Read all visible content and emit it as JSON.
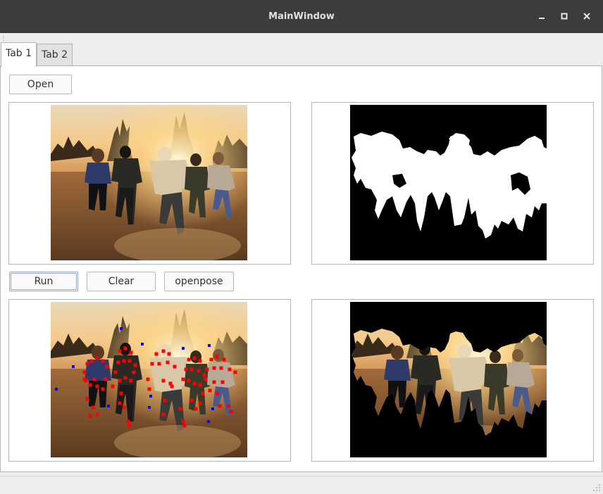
{
  "window": {
    "title": "MainWindow"
  },
  "tabs": [
    {
      "label": "Tab 1",
      "active": true
    },
    {
      "label": "Tab 2",
      "active": false
    }
  ],
  "toolbar": {
    "open_label": "Open",
    "run_label": "Run",
    "clear_label": "Clear",
    "openpose_label": "openpose"
  },
  "colors": {
    "titlebar": "#3c3c3c",
    "keypoint_red": "#ff0000",
    "keypoint_blue": "#0000ff",
    "mask_bg": "#000000",
    "mask_fg": "#ffffff"
  },
  "icons": {
    "minimize": "minimize-icon",
    "maximize": "maximize-icon",
    "close": "close-icon"
  }
}
